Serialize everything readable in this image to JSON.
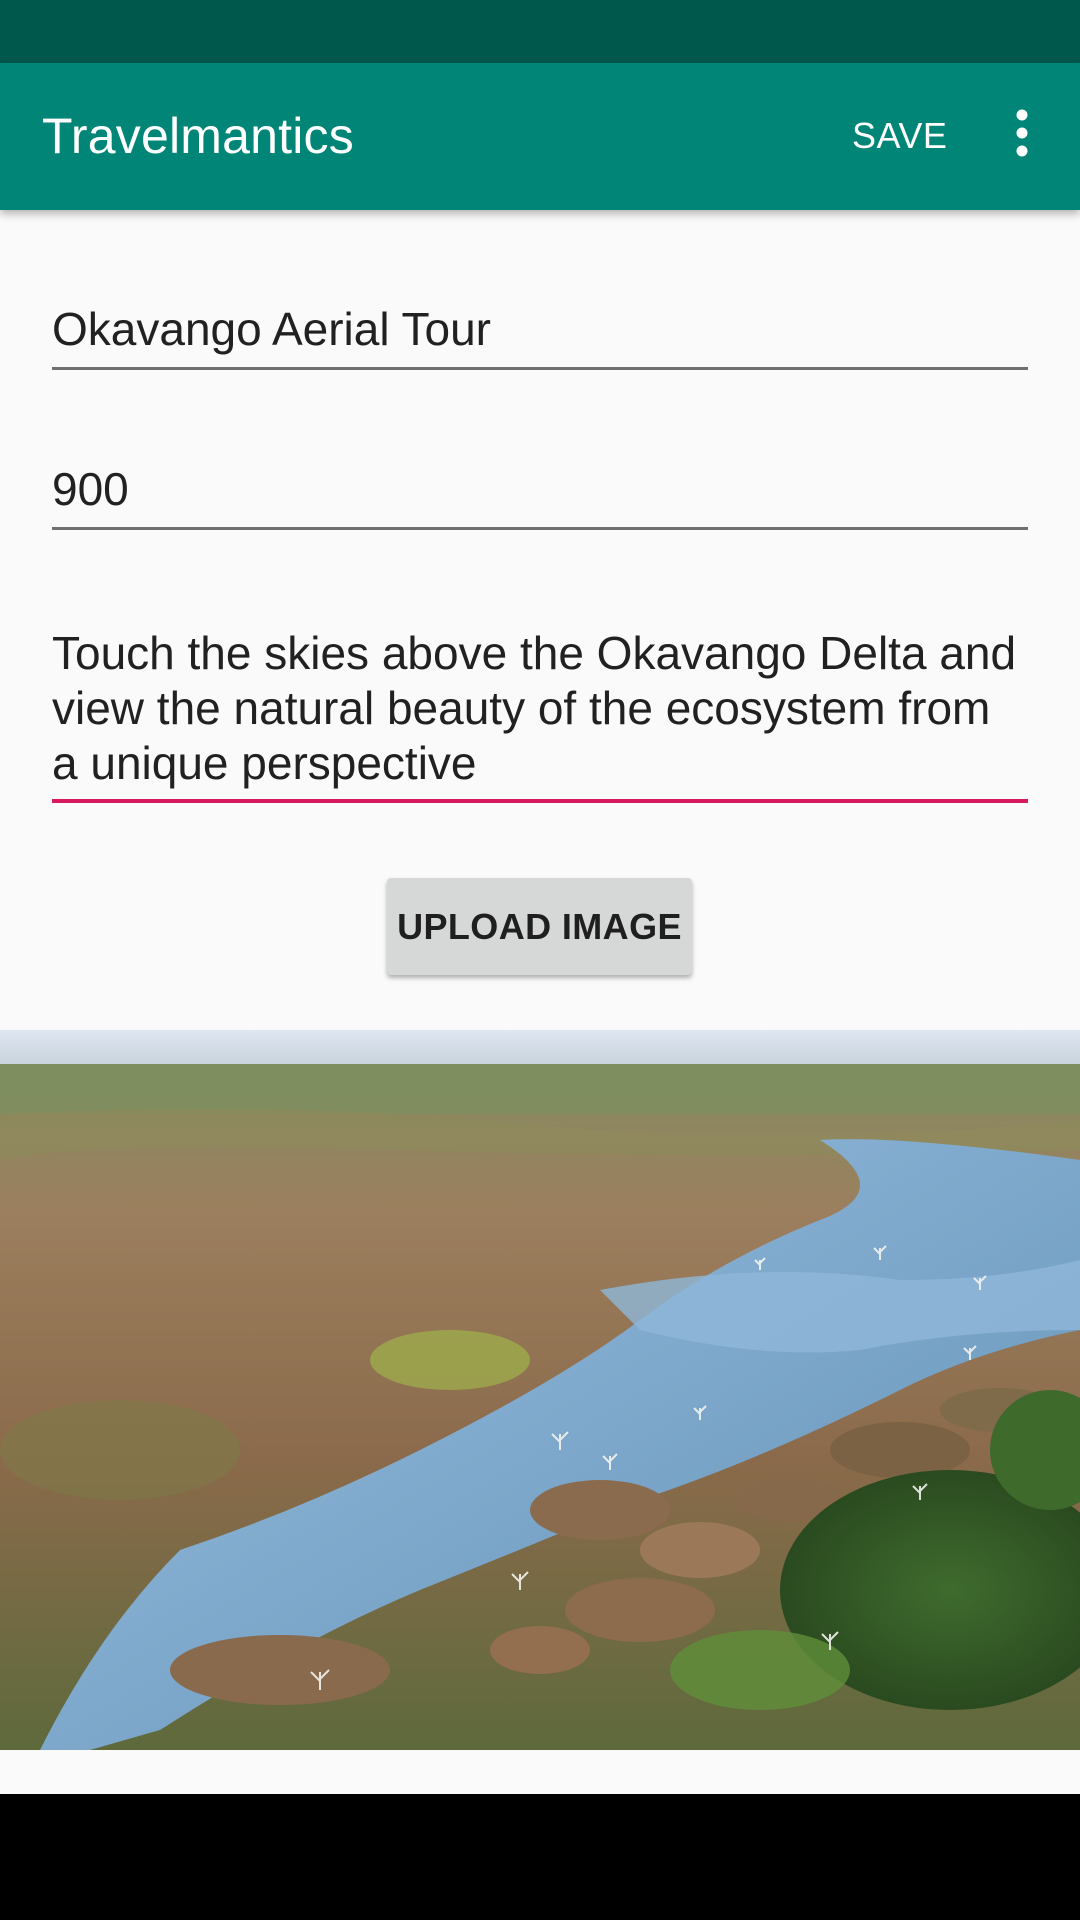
{
  "app_bar": {
    "title": "Travelmantics",
    "save_label": "SAVE",
    "overflow_icon": "more-vert-icon",
    "background": "#008577",
    "status_bar_color": "#00574B"
  },
  "form": {
    "title_value": "Okavango Aerial Tour",
    "price_value": "900",
    "description_value": "Touch the skies above the Okavango Delta and view the natural beauty of the ecosystem from a unique perspective",
    "focus_accent": "#D81B60"
  },
  "upload_button": {
    "label": "UPLOAD IMAGE"
  }
}
